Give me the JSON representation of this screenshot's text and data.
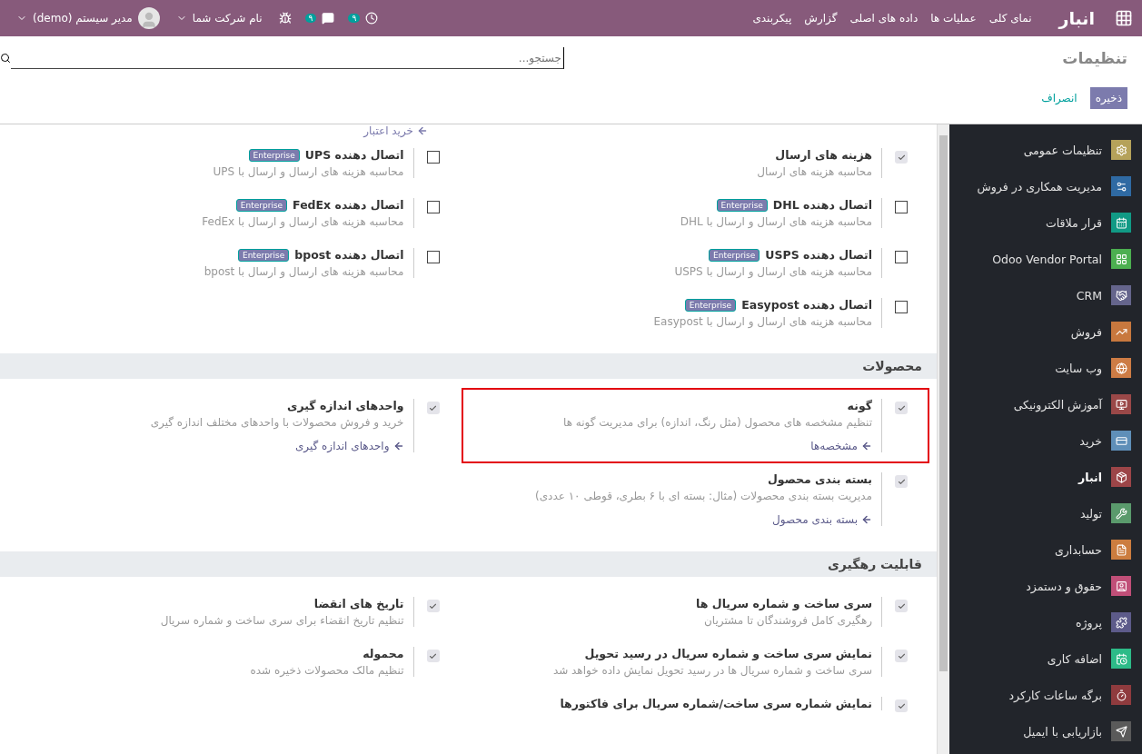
{
  "topbar": {
    "brand": "انبار",
    "menu": [
      "نمای کلی",
      "عملیات ها",
      "داده های اصلی",
      "گزارش",
      "پیکربندی"
    ],
    "activity_count": "۹",
    "message_count": "۹",
    "company": "نام شرکت شما",
    "user": "مدیر سیستم (demo)"
  },
  "control_panel": {
    "breadcrumb": "تنظیمات",
    "search": {
      "placeholder": "جستجو..."
    },
    "buttons": [
      {
        "kind": "primary",
        "label": "ذخیره"
      },
      {
        "kind": "link",
        "label": "انصراف"
      }
    ]
  },
  "top_link": "خرید اعتبار",
  "sections": [
    {
      "settings": [
        {
          "title": "هزینه های ارسال",
          "description": "محاسبه هزینه های ارسال",
          "checked": true,
          "highlighted": false
        },
        {
          "title": "اتصال دهنده UPS",
          "badge": "Enterprise",
          "description": "محاسبه هزینه های ارسال و ارسال با UPS",
          "checked": false,
          "highlighted": false
        },
        {
          "title": "اتصال دهنده DHL",
          "badge": "Enterprise",
          "description": "محاسبه هزینه های ارسال و ارسال با DHL",
          "checked": false,
          "highlighted": false
        },
        {
          "title": "اتصال دهنده FedEx",
          "badge": "Enterprise",
          "description": "محاسبه هزینه های ارسال و ارسال با FedEx",
          "checked": false,
          "highlighted": false
        },
        {
          "title": "اتصال دهنده USPS",
          "badge": "Enterprise",
          "description": "محاسبه هزینه های ارسال و ارسال با USPS",
          "checked": false,
          "highlighted": false
        },
        {
          "title": "اتصال دهنده bpost",
          "badge": "Enterprise",
          "description": "محاسبه هزینه های ارسال و ارسال با bpost",
          "checked": false,
          "highlighted": false
        },
        {
          "title": "اتصال دهنده Easypost",
          "badge": "Enterprise",
          "description": "محاسبه هزینه های ارسال و ارسال با Easypost",
          "checked": false,
          "highlighted": false
        }
      ]
    },
    {
      "title": "محصولات",
      "settings": [
        {
          "title": "گونه",
          "description": "تنظیم مشخصه های محصول (مثل رنگ، اندازه) برای مدیریت گونه ها",
          "link": "مشخصه‌ها",
          "checked": true,
          "highlighted": true
        },
        {
          "title": "واحدهای اندازه گیری",
          "description": "خرید و فروش محصولات با واحدهای مختلف اندازه گیری",
          "link": "واحدهای اندازه گیری",
          "checked": true,
          "highlighted": false
        },
        {
          "title": "بسته بندی محصول",
          "description": "مدیریت بسته بندی محصولات (مثال: بسته ای با ۶ بطری، قوطی ۱۰ عددی)",
          "link": "بسته بندی محصول",
          "checked": true,
          "highlighted": false
        }
      ]
    },
    {
      "title": "قابلیت رهگیری",
      "settings": [
        {
          "title": "سری ساخت و شماره سریال ها",
          "description": "رهگیری کامل فروشندگان تا مشتریان",
          "checked": true,
          "highlighted": false
        },
        {
          "title": "تاریخ های انقضا",
          "description": "تنظیم تاریخ انقضاء برای سری ساخت و شماره سریال",
          "checked": true,
          "highlighted": false
        },
        {
          "title": "نمایش سری ساخت و شماره سریال در رسید تحویل",
          "description": "سری ساخت و شماره سریال ها در رسید تحویل نمایش داده خواهد شد",
          "checked": true,
          "highlighted": false
        },
        {
          "title": "محموله",
          "description": "تنظیم مالک محصولات ذخیره شده",
          "checked": true,
          "highlighted": false
        },
        {
          "title": "نمایش شماره سری ساخت/شماره سریال برای فاکتورها",
          "checked": true,
          "highlighted": false
        }
      ]
    }
  ],
  "sidebar": {
    "items": [
      {
        "label": "تنظیمات عمومی",
        "color": "#b5a25a",
        "selected": false
      },
      {
        "label": "مدیریت همکاری در فروش",
        "color": "#2f6aa3",
        "selected": false
      },
      {
        "label": "قرار ملاقات",
        "color": "#119a85",
        "selected": false
      },
      {
        "label": "Odoo Vendor Portal",
        "color": "#4caf50",
        "selected": false
      },
      {
        "label": "CRM",
        "color": "#65658c",
        "selected": false
      },
      {
        "label": "فروش",
        "color": "#c8783e",
        "selected": false
      },
      {
        "label": "وب سایت",
        "color": "#cd7c45",
        "selected": false
      },
      {
        "label": "آموزش الکترونیکی",
        "color": "#9a4848",
        "selected": false
      },
      {
        "label": "خرید",
        "color": "#5f8fb8",
        "selected": false
      },
      {
        "label": "انبار",
        "color": "#9c4548",
        "selected": true
      },
      {
        "label": "تولید",
        "color": "#5a9a6c",
        "selected": false
      },
      {
        "label": "حسابداری",
        "color": "#cc7d3f",
        "selected": false
      },
      {
        "label": "حقوق و دستمزد",
        "color": "#c04f78",
        "selected": false
      },
      {
        "label": "پروژه",
        "color": "#5d5b8a",
        "selected": false
      },
      {
        "label": "اضافه کاری",
        "color": "#2dbb88",
        "selected": false
      },
      {
        "label": "برگه ساعات کارکرد",
        "color": "#8f3b3e",
        "selected": false
      },
      {
        "label": "بازاریابی با ایمیل",
        "color": "#5a5a5a",
        "selected": false
      }
    ]
  }
}
